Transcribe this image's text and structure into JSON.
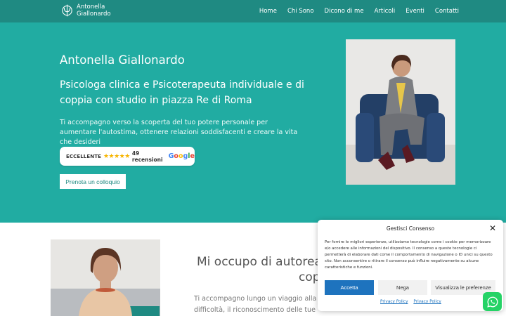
{
  "header": {
    "brand": {
      "line1": "Antonella",
      "line2": "Giallonardo"
    },
    "nav": [
      {
        "label": "Home"
      },
      {
        "label": "Chi Sono"
      },
      {
        "label": "Dicono di me"
      },
      {
        "label": "Articoli"
      },
      {
        "label": "Eventi"
      },
      {
        "label": "Contatti"
      }
    ]
  },
  "hero": {
    "name": "Antonella Giallonardo",
    "subtitle": "Psicologa clinica e Psicoterapeuta individuale e di coppia con studio in piazza Re di Roma",
    "description": "Ti accompagno verso la scoperta del tuo potere personale per aumentare l'autostima, ottenere relazioni soddisfacenti e creare la vita che desideri",
    "reviews": {
      "label": "ECCELLENTE",
      "stars": "★★★★★",
      "count": "49 recensioni",
      "google": [
        "G",
        "o",
        "o",
        "g",
        "l",
        "e"
      ]
    },
    "cta": "Prenota un colloquio"
  },
  "section2": {
    "title_line1": "Mi occupo di autorealiz",
    "title_line2": "cop",
    "text_line1": "Ti accompagno lungo un viaggio alla sco",
    "text_line2": "difficoltà, il riconoscimento delle tue"
  },
  "consent": {
    "title": "Gestisci Consenso",
    "close": "✕",
    "text": "Per fornire le migliori esperienze, utilizziamo tecnologie come i cookie per memorizzare e/o accedere alle informazioni del dispositivo. Il consenso a queste tecnologie ci permetterà di elaborare dati come il comportamento di navigazione o ID unici su questo sito. Non acconsentire o ritirare il consenso può influire negativamente su alcune caratteristiche e funzioni.",
    "accept": "Accetta",
    "deny": "Nega",
    "preferences": "Visualizza le preferenze",
    "links": [
      "Privacy Policy",
      "Privacy Policy"
    ]
  },
  "colors": {
    "header_bg": "#1f8a82",
    "hero_bg": "#21aca2",
    "accept_bg": "#1e73be",
    "whatsapp": "#25d366",
    "stars": "#f7b500"
  }
}
